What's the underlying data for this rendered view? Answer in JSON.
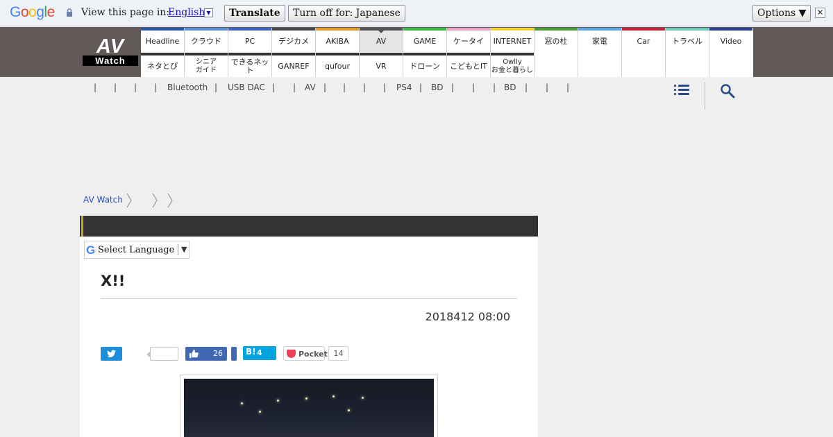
{
  "translate_bar": {
    "brand": "Google",
    "prompt": "View this page in:",
    "language": "English",
    "translate_label": "Translate",
    "turn_off_label": "Turn off for: Japanese",
    "options_label": "Options ▼",
    "close_label": "✕"
  },
  "site": {
    "logo_top": "AV",
    "logo_bottom": "Watch"
  },
  "nav": {
    "row1": [
      {
        "label": "Headline",
        "color": "#2b56a8"
      },
      {
        "label": "クラウド",
        "color": "#5b8fd0"
      },
      {
        "label": "PC",
        "color": "#3f62c0"
      },
      {
        "label": "デジカメ",
        "color": "#4a4a4a"
      },
      {
        "label": "AKIBA",
        "color": "#e39a2d"
      },
      {
        "label": "AV",
        "color": "#555555"
      },
      {
        "label": "GAME",
        "color": "#3fb84a"
      },
      {
        "label": "ケータイ",
        "color": "#e7a3c8"
      },
      {
        "label": "INTERNET",
        "color": "#f2d43a"
      },
      {
        "label": "窓の杜",
        "color": "#4f9a3a"
      },
      {
        "label": "家電",
        "color": "#5aa7de"
      },
      {
        "label": "Car",
        "color": "#c2243a"
      },
      {
        "label": "トラベル",
        "color": "#6fc7b5"
      },
      {
        "label": "Video",
        "color": "#2b3f8a"
      }
    ],
    "row2": [
      {
        "label": "ネタとぴ"
      },
      {
        "label": "シニア\nガイド"
      },
      {
        "label": "できるネット"
      },
      {
        "label": "GANREF"
      },
      {
        "label": "qufour"
      },
      {
        "label": "VR"
      },
      {
        "label": "ドローン"
      },
      {
        "label": "こどもとIT"
      },
      {
        "label": "Owlly\nお金と暮らし"
      }
    ]
  },
  "subnav": {
    "items": [
      "|",
      "|",
      "|",
      "|",
      "Bluetooth",
      "|",
      "USB DAC",
      "|",
      "|",
      "AV",
      "|",
      "|",
      "|",
      "|",
      "PS4",
      "|",
      "BD",
      "|",
      "|",
      "|",
      "BD",
      "|",
      "|",
      "|"
    ]
  },
  "breadcrumb": {
    "home": "AV Watch"
  },
  "article": {
    "select_language": "Select Language",
    "select_arrow": "▼",
    "title": "X!!",
    "date": "2018412 08:00",
    "fb_count": "26",
    "hatena_label": "B!",
    "hatena_count": "4",
    "pocket_label": "Pocket",
    "pocket_count": "14"
  }
}
